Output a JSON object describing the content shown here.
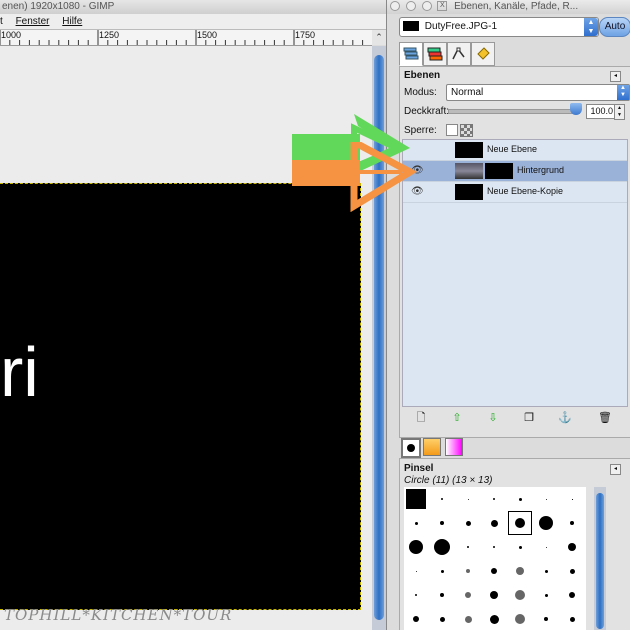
{
  "image_window": {
    "title": "enen) 1920x1080 - GIMP",
    "menu": {
      "first": "t",
      "fenster": "Fenster",
      "hilfe": "Hilfe"
    },
    "ruler_labels": [
      "1000",
      "1250",
      "1500",
      "1750"
    ],
    "ruler_corner": "⌃",
    "canvas_text": "ri",
    "watermark": "TOPHILL*KITCHEN*TOUR"
  },
  "dock": {
    "title": "Ebenen, Kanäle, Pfade, R...",
    "image_selector": "DutyFree.JPG-1",
    "auto_button": "Auto",
    "layers_panel": {
      "title": "Ebenen",
      "mode_label": "Modus:",
      "mode_value": "Normal",
      "opacity_label": "Deckkraft:",
      "opacity_value": "100.0",
      "opacity_percent": 100,
      "lock_label": "Sperre:",
      "layers": [
        {
          "name": "Neue Ebene",
          "visible": false,
          "selected": false
        },
        {
          "name": "Hintergrund",
          "visible": true,
          "selected": true
        },
        {
          "name": "Neue Ebene-Kopie",
          "visible": true,
          "selected": false
        }
      ]
    },
    "brushes_panel": {
      "title": "Pinsel",
      "subtitle": "Circle (11) (13 × 13)"
    }
  },
  "colors": {
    "annotation_green": "#62d85a",
    "annotation_orange": "#f59342",
    "selection": "#9bb2d8",
    "accent_blue": "#2f6fce"
  }
}
